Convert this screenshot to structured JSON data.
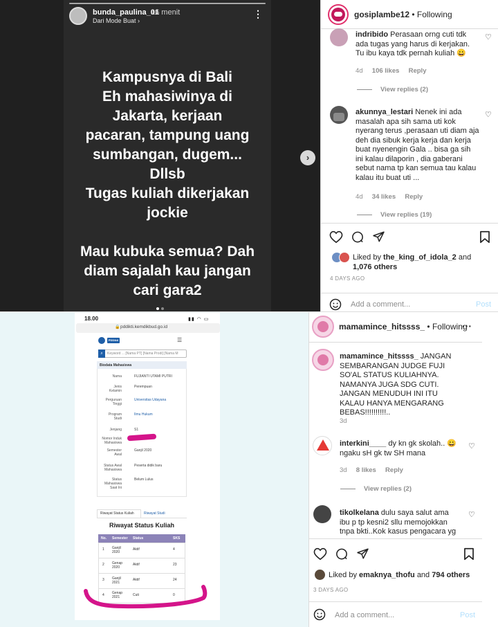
{
  "story": {
    "username": "bunda_paulina_01",
    "time": "16 menit",
    "subtitle": "Dari Mode Buat",
    "more_icon": "⋮",
    "text": "Kampusnya di Bali\nEh mahasiwinya di\nJakarta, kerjaan\npacaran, tampung uang\nsumbangan, dugem...\nDllsb\nTugas kuliah dikerjakan\njockie\n\nMau kubuka semua? Dah\ndiam sajalah kau jangan\ncari gara2",
    "next_icon": "›"
  },
  "post1": {
    "username": "gosiplambe12",
    "follow_status": "Following",
    "separator": "•",
    "more_icon": "···",
    "comments": [
      {
        "user": "indribido",
        "text": "Perasaan orng cuti tdk ada tugas yang harus di kerjakan. Tu ibu kaya tdk pernah kuliah 😀",
        "age": "4d",
        "likes": "106 likes",
        "reply": "Reply",
        "view_replies": "View replies (2)"
      },
      {
        "user": "akunnya_lestari",
        "text": "Nenek ini ada masalah apa sih sama uti kok nyerang terus ,perasaan uti diam aja deh dia sibuk kerja kerja dan kerja buat nyenengin Gala .. bisa ga sih ini kalau dilaporin , dia gaberani sebut nama tp kan semua tau kalau kalau itu buat uti ...",
        "age": "4d",
        "likes": "34 likes",
        "reply": "Reply",
        "view_replies": "View replies (19)"
      }
    ],
    "liked_by_prefix": "Liked by",
    "liked_by_user": "the_king_of_idola_2",
    "liked_by_and": "and",
    "liked_by_others": "1,076 others",
    "date": "4 DAYS AGO",
    "add_comment_placeholder": "Add a comment...",
    "post_label": "Post"
  },
  "post2": {
    "username": "mamamince_hitssss_",
    "follow_status": "Following",
    "separator": "•",
    "more_icon": "···",
    "caption_user": "mamamince_hitssss_",
    "caption_text": "JANGAN SEMBARANGAN JUDGE FUJI SO'AL STATUS KULIAHNYA. NAMANYA JUGA SDG CUTI. JANGAN MENUDUH INI ITU KALAU HANYA MENGARANG BEBAS!!!!!!!!!!..",
    "caption_age": "3d",
    "comments": [
      {
        "user": "interkini____",
        "text": "dy kn gk skolah.. 😀 ngaku sH gk tw SH mana",
        "age": "3d",
        "likes": "8 likes",
        "reply": "Reply",
        "view_replies": "View replies (2)"
      },
      {
        "user": "tikolkelana",
        "text": "dulu saya salut ama ibu p tp kesni2 sllu memojokkan tnpa bkti..Kok kasus pengacara yg menggelu bu paulina gk ada kabr"
      }
    ],
    "liked_by_prefix": "Liked by",
    "liked_by_user": "emaknya_thofu",
    "liked_by_and": "and",
    "liked_by_others": "794 others",
    "date": "3 DAYS AGO",
    "add_comment_placeholder": "Add a comment...",
    "post_label": "Post"
  },
  "phone": {
    "time": "18.00",
    "url": "pddikti.kemdikbud.go.id",
    "search_placeholder": "Keyword ... [Nama PT] [Nama Prodi] [Nama M",
    "section_title": "Biodata Mahasiswa",
    "fields": [
      {
        "label": "Nama",
        "value": "FUJIANTI UTAMI PUTRI"
      },
      {
        "label": "Jenis Kelamin",
        "value": "Perempuan"
      },
      {
        "label": "Perguruan Tinggi",
        "value": "Universitas Udayana"
      },
      {
        "label": "Program Studi",
        "value": "Ilmu Hukum"
      },
      {
        "label": "Jenjang",
        "value": "S1"
      },
      {
        "label": "Nomor Induk Mahasiswa",
        "value": ""
      },
      {
        "label": "Semester Awal",
        "value": "Ganjil 2020"
      },
      {
        "label": "Status Awal Mahasiswa",
        "value": "Peserta didik baru"
      },
      {
        "label": "Status Mahasiswa Saat Ini",
        "value": "Belum Lulus"
      }
    ],
    "tabs": [
      "Riwayat Status Kuliah",
      "Riwayat Studi"
    ],
    "table_title": "Riwayat Status Kuliah",
    "table_headers": [
      "No.",
      "Semester",
      "Status",
      "SKS"
    ],
    "table_rows": [
      [
        "1",
        "Ganjil 2020",
        "Aktif",
        "4"
      ],
      [
        "2",
        "Genap 2020",
        "Aktif",
        "23"
      ],
      [
        "3",
        "Ganjil 2021",
        "Aktif",
        "24"
      ],
      [
        "4",
        "Genap 2021",
        "Cuti",
        "0"
      ]
    ]
  },
  "colors": {
    "story_bg": "#202020",
    "accent_blue": "#0095f6",
    "highlight_pink": "#d4148a",
    "table_header": "#8c83b8"
  }
}
